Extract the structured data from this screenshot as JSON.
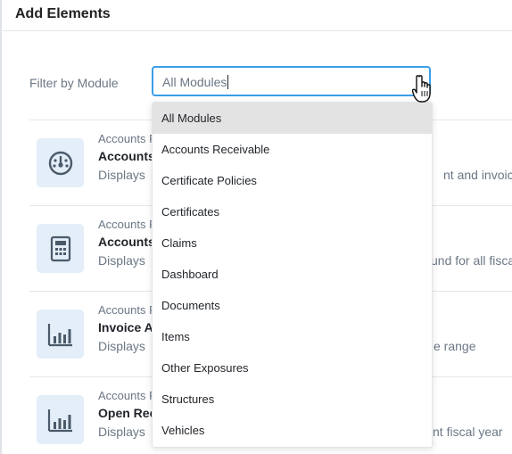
{
  "header": {
    "title": "Add Elements"
  },
  "filter": {
    "label": "Filter by Module",
    "value": "All Modules",
    "options": [
      "All Modules",
      "Accounts Receivable",
      "Certificate Policies",
      "Certificates",
      "Claims",
      "Dashboard",
      "Documents",
      "Items",
      "Other Exposures",
      "Structures",
      "Vehicles"
    ],
    "selected_index": 0
  },
  "elements": [
    {
      "icon": "speedometer-icon",
      "category": "Accounts R",
      "title": "Accounts",
      "desc": "Displays",
      "desc_tail": "nt and invoices"
    },
    {
      "icon": "calculator-icon",
      "category": "Accounts R",
      "title": "Accounts",
      "desc": "Displays",
      "desc_tail": "und for all fisca"
    },
    {
      "icon": "bar-chart-icon",
      "category": "Accounts R",
      "title": "Invoice A",
      "desc": "Displays",
      "desc_tail": "e range"
    },
    {
      "icon": "bar-chart-icon",
      "category": "Accounts R",
      "title": "Open Rec",
      "desc": "Displays",
      "desc_tail": "nt fiscal year"
    }
  ],
  "colors": {
    "accent": "#3b9ee8",
    "icon_bg": "#e3eef8",
    "icon_fg": "#4a5a6a",
    "selected_option_bg": "#e3e3e3"
  }
}
